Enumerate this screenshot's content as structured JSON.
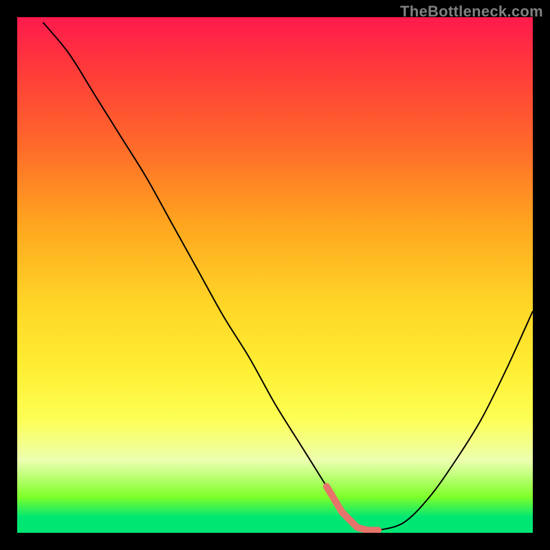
{
  "watermark": "TheBottleneck.com",
  "colors": {
    "curve": "#000000",
    "optimal_segment": "#e7746a",
    "frame": "#000000"
  },
  "chart_data": {
    "type": "line",
    "title": "",
    "xlabel": "",
    "ylabel": "",
    "xlim": [
      0,
      100
    ],
    "ylim": [
      0,
      100
    ],
    "x": [
      5,
      10,
      15,
      20,
      25,
      30,
      35,
      40,
      45,
      50,
      55,
      60,
      63,
      66,
      68,
      70,
      75,
      80,
      85,
      90,
      95,
      100
    ],
    "values": [
      99,
      93,
      85,
      77,
      69,
      60,
      51,
      42,
      34,
      25,
      17,
      9,
      4,
      1,
      0.5,
      0.5,
      2,
      7,
      14,
      22,
      32,
      43
    ],
    "optimal_range_x": [
      60,
      70
    ],
    "annotations": []
  }
}
